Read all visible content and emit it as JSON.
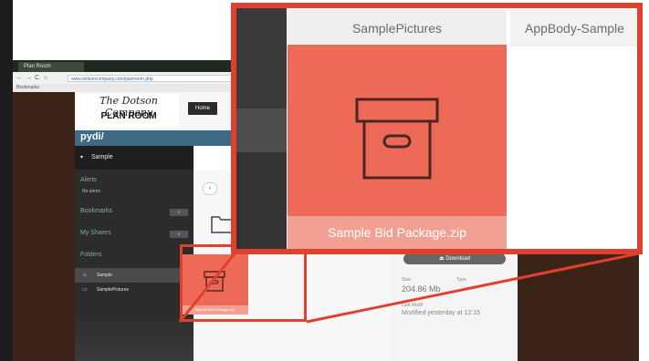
{
  "browser": {
    "tab_title": "Plan Room",
    "nav": {
      "back": "←",
      "forward": "→",
      "reload": "C",
      "home": "⌂"
    },
    "url": "www.dotsoncompany.com/planroom.php",
    "bookmarks_label": "Bookmarks"
  },
  "site": {
    "logo_script": "The Dotson Company",
    "logo_planroom": "PLAN ROOM",
    "home_button": "Home"
  },
  "pydio": {
    "logo": "pydi/",
    "workspace": "Sample",
    "sections": {
      "alerts": "Alerts",
      "no_alerts": "No alerts",
      "bookmarks": "Bookmarks",
      "bookmarks_count": "0",
      "shares": "My Shares",
      "shares_count": "0",
      "folders": "Folders"
    },
    "folders": [
      {
        "label": "Sample"
      },
      {
        "label": "SamplePictures"
      }
    ],
    "back_glyph": "‹",
    "folder_thumb_label": "SamplePictures",
    "small_zip_label": "Sample Bid Package.zip"
  },
  "info_panel": {
    "download": "Download",
    "size_key": "Size",
    "type_key": "Type",
    "size": "204.86 Mb",
    "modified_key": "Last Modif",
    "modified": "Modified yesterday at 12:15"
  },
  "callout": {
    "tile_pictures": "SamplePictures",
    "tile_appbody": "AppBody-Sample",
    "tile_zip": "Sample Bid Package.zip"
  },
  "colors": {
    "highlight": "#e2402e",
    "zip_tile": "#ee6a58",
    "zip_label_band": "#f2a094",
    "pydio_header": "#3f6a86"
  },
  "icons": {
    "zip_icon": "archive-box-icon",
    "folder_icon": "folder-icon",
    "download_icon": "download-icon"
  }
}
